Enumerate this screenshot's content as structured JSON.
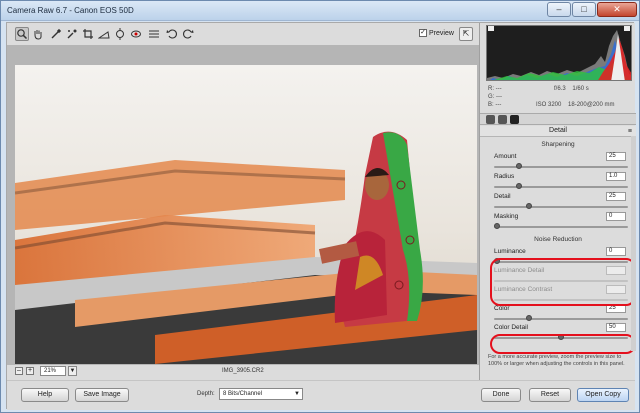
{
  "window": {
    "title": "Camera Raw 6.7  -  Canon EOS 50D",
    "controls": [
      "–",
      "□",
      "✕"
    ]
  },
  "toolbar": {
    "tools": [
      "zoom-icon",
      "hand-icon",
      "white-balance-icon",
      "color-sampler-icon",
      "crop-icon",
      "straighten-icon",
      "spot-removal-icon",
      "red-eye-icon",
      "preferences-icon",
      "rotate-left-icon",
      "rotate-right-icon"
    ],
    "preview_label": "Preview",
    "preview_checked": "✓",
    "fullscreen_icon": "⇱"
  },
  "status": {
    "zoom_value": "21%",
    "zoom_out": "–",
    "zoom_in": "+",
    "zoom_arrow": "▼",
    "filename": "IMG_3905.CR2"
  },
  "histogram": {
    "r_label": "R:",
    "g_label": "G:",
    "b_label": "B:",
    "r_value": "---",
    "g_value": "---",
    "b_value": "---",
    "aperture": "f/6.3",
    "shutter": "1/60 s",
    "iso": "ISO 3200",
    "lens": "18-200@200 mm"
  },
  "panel": {
    "title": "Detail",
    "menu_icon": "≡",
    "sharpening_title": "Sharpening",
    "noise_title": "Noise Reduction",
    "sharpening": [
      {
        "label": "Amount",
        "value": "25",
        "fraction": 0.17,
        "enabled": true
      },
      {
        "label": "Radius",
        "value": "1.0",
        "fraction": 0.17,
        "enabled": true
      },
      {
        "label": "Detail",
        "value": "25",
        "fraction": 0.25,
        "enabled": true
      },
      {
        "label": "Masking",
        "value": "0",
        "fraction": 0.0,
        "enabled": true
      }
    ],
    "noise": [
      {
        "label": "Luminance",
        "value": "0",
        "fraction": 0.0,
        "enabled": true
      },
      {
        "label": "Luminance Detail",
        "value": "",
        "fraction": 0.0,
        "enabled": false
      },
      {
        "label": "Luminance Contrast",
        "value": "",
        "fraction": 0.0,
        "enabled": false
      },
      {
        "label": "Color",
        "value": "25",
        "fraction": 0.25,
        "enabled": true
      },
      {
        "label": "Color Detail",
        "value": "50",
        "fraction": 0.5,
        "enabled": true
      }
    ],
    "note": "For a more accurate preview, zoom the preview size to 100% or larger when adjusting the controls in this panel."
  },
  "bottom": {
    "help": "Help",
    "save": "Save Image",
    "depth_label": "Depth:",
    "depth_value": "8 Bits/Channel",
    "done": "Done",
    "reset": "Reset",
    "open": "Open Copy"
  },
  "colors": {
    "annotation": "#e4101d",
    "accent": "#5f84b3"
  }
}
